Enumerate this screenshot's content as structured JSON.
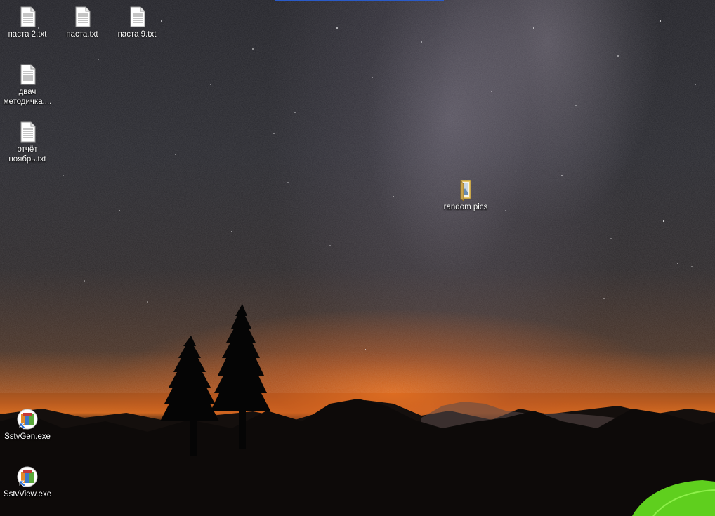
{
  "desktop": {
    "icons": [
      {
        "label": "паста 2.txt",
        "type": "text-file"
      },
      {
        "label": "паста.txt",
        "type": "text-file"
      },
      {
        "label": "паста 9.txt",
        "type": "text-file"
      },
      {
        "label_line1": "двач",
        "label_line2": "методичка....",
        "type": "text-file"
      },
      {
        "label_line1": "отчёт",
        "label_line2": "ноябрь.txt",
        "type": "text-file"
      },
      {
        "label": "random pics",
        "type": "folder"
      },
      {
        "label": "SstvGen.exe",
        "type": "application"
      },
      {
        "label": "SstvView.exe",
        "type": "application"
      }
    ]
  },
  "colors": {
    "taskbar_accent": "#2a5bc9",
    "horizon_glow": "#d26a22",
    "tent_green": "#5fcf1e"
  }
}
